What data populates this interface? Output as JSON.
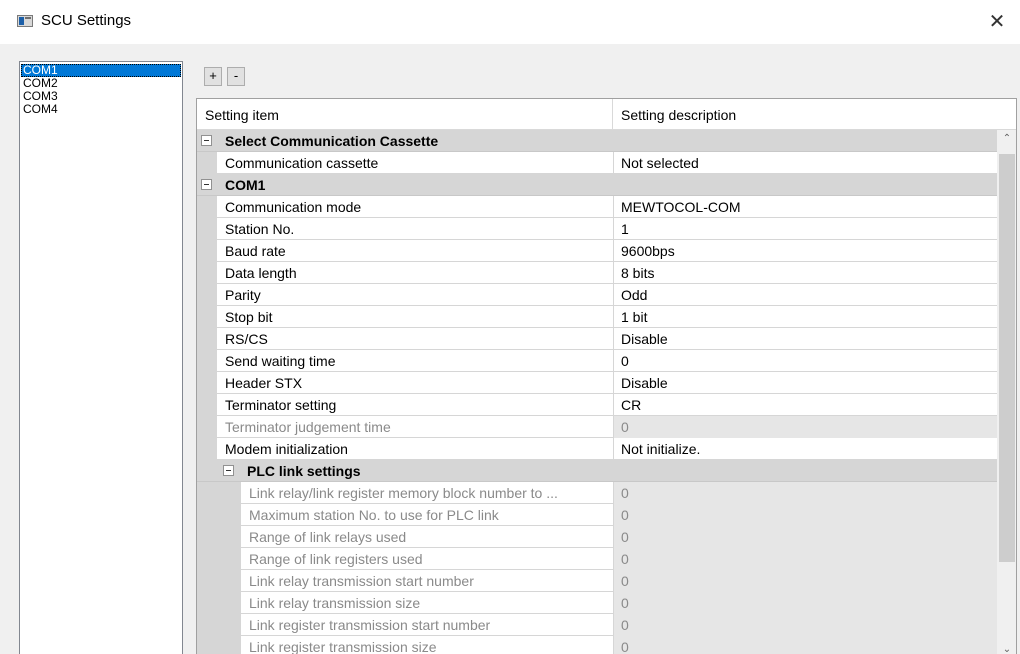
{
  "window": {
    "title": "SCU Settings",
    "close_glyph": "✕"
  },
  "ports": [
    "COM1",
    "COM2",
    "COM3",
    "COM4"
  ],
  "toolbar": {
    "add_label": "+",
    "remove_label": "-"
  },
  "grid": {
    "col_item": "Setting item",
    "col_desc": "Setting description",
    "rows": [
      {
        "type": "category",
        "label": "Select Communication Cassette"
      },
      {
        "type": "item",
        "name": "Communication cassette",
        "value": "Not selected"
      },
      {
        "type": "category",
        "label": "COM1"
      },
      {
        "type": "item",
        "name": "Communication mode",
        "value": "MEWTOCOL-COM"
      },
      {
        "type": "item",
        "name": "Station No.",
        "value": "1"
      },
      {
        "type": "item",
        "name": "Baud rate",
        "value": "9600bps"
      },
      {
        "type": "item",
        "name": "Data length",
        "value": "8 bits"
      },
      {
        "type": "item",
        "name": "Parity",
        "value": "Odd"
      },
      {
        "type": "item",
        "name": "Stop bit",
        "value": "1 bit"
      },
      {
        "type": "item",
        "name": "RS/CS",
        "value": "Disable"
      },
      {
        "type": "item",
        "name": "Send waiting time",
        "value": "0"
      },
      {
        "type": "item",
        "name": "Header STX",
        "value": "Disable"
      },
      {
        "type": "item",
        "name": "Terminator setting",
        "value": "CR"
      },
      {
        "type": "item",
        "name": "Terminator judgement time",
        "value": "0",
        "disabled": true
      },
      {
        "type": "item",
        "name": "Modem initialization",
        "value": "Not initialize."
      },
      {
        "type": "category",
        "label": "PLC link settings",
        "deep": true
      },
      {
        "type": "item",
        "name": "Link relay/link register memory block number to ...",
        "value": "0",
        "disabled": true,
        "deep": true
      },
      {
        "type": "item",
        "name": "Maximum station No. to use for PLC link",
        "value": "0",
        "disabled": true,
        "deep": true
      },
      {
        "type": "item",
        "name": "Range of link relays used",
        "value": "0",
        "disabled": true,
        "deep": true
      },
      {
        "type": "item",
        "name": "Range of link registers used",
        "value": "0",
        "disabled": true,
        "deep": true
      },
      {
        "type": "item",
        "name": "Link relay transmission start number",
        "value": "0",
        "disabled": true,
        "deep": true
      },
      {
        "type": "item",
        "name": "Link relay transmission size",
        "value": "0",
        "disabled": true,
        "deep": true
      },
      {
        "type": "item",
        "name": "Link register transmission start number",
        "value": "0",
        "disabled": true,
        "deep": true
      },
      {
        "type": "item",
        "name": "Link register transmission size",
        "value": "0",
        "disabled": true,
        "deep": true
      }
    ]
  },
  "scroll": {
    "up_glyph": "⌃",
    "down_glyph": "⌄"
  },
  "colors": {
    "selection": "#0078d7",
    "category_bg": "#d6d6d6",
    "disabled_text": "#8a8a8a"
  }
}
